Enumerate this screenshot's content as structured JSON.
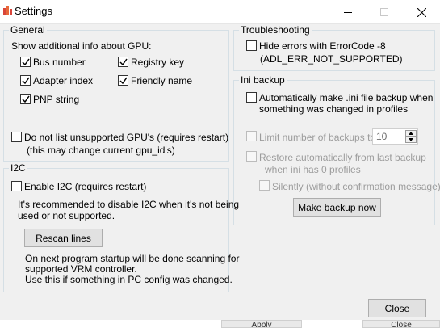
{
  "window": {
    "title": "Settings",
    "controls": [
      "minimize",
      "maximize",
      "close"
    ]
  },
  "general": {
    "title": "General",
    "gpu_info_label": "Show additional info about GPU:",
    "options": [
      {
        "label": "Bus number",
        "checked": true
      },
      {
        "label": "Registry key",
        "checked": true
      },
      {
        "label": "Adapter index",
        "checked": true
      },
      {
        "label": "Friendly name",
        "checked": true
      },
      {
        "label": "PNP string",
        "checked": true
      }
    ],
    "unsupported": {
      "label_line1": "Do not list unsupported GPU's (requires restart)",
      "label_line2": "(this may change current gpu_id's)",
      "checked": false
    }
  },
  "i2c": {
    "title": "I2C",
    "enable_label": "Enable I2C (requires restart)",
    "enable_checked": false,
    "note_line1": "It's recommended to disable I2C when it's not being",
    "note_line2": "used or not supported.",
    "rescan_button": "Rescan lines",
    "info_line1": "On next program startup will be done scanning for",
    "info_line2": "supported VRM controller.",
    "info_line3": "Use this if something in PC config was changed."
  },
  "troubleshooting": {
    "title": "Troubleshooting",
    "hide_errors_line1": "Hide errors with ErrorCode -8",
    "hide_errors_line2": "(ADL_ERR_NOT_SUPPORTED)",
    "hide_errors_checked": false
  },
  "ini_backup": {
    "title": "Ini backup",
    "auto_backup_line1": "Automatically make .ini file backup when",
    "auto_backup_line2": "something was changed in profiles",
    "auto_backup_checked": false,
    "limit_label": "Limit number of backups to",
    "limit_value": "10",
    "restore_line1": "Restore automatically from last backup",
    "restore_line2": "when ini has 0 profiles",
    "silently_label": "Silently (without confirmation message)",
    "make_backup_button": "Make backup now"
  },
  "footer": {
    "close_button": "Close",
    "strip_left": "Apply",
    "strip_right": "Close"
  },
  "colors": {
    "checkmark": "#000000",
    "disabled_text": "#9c9c9c",
    "group_border": "#d5dfe5"
  }
}
